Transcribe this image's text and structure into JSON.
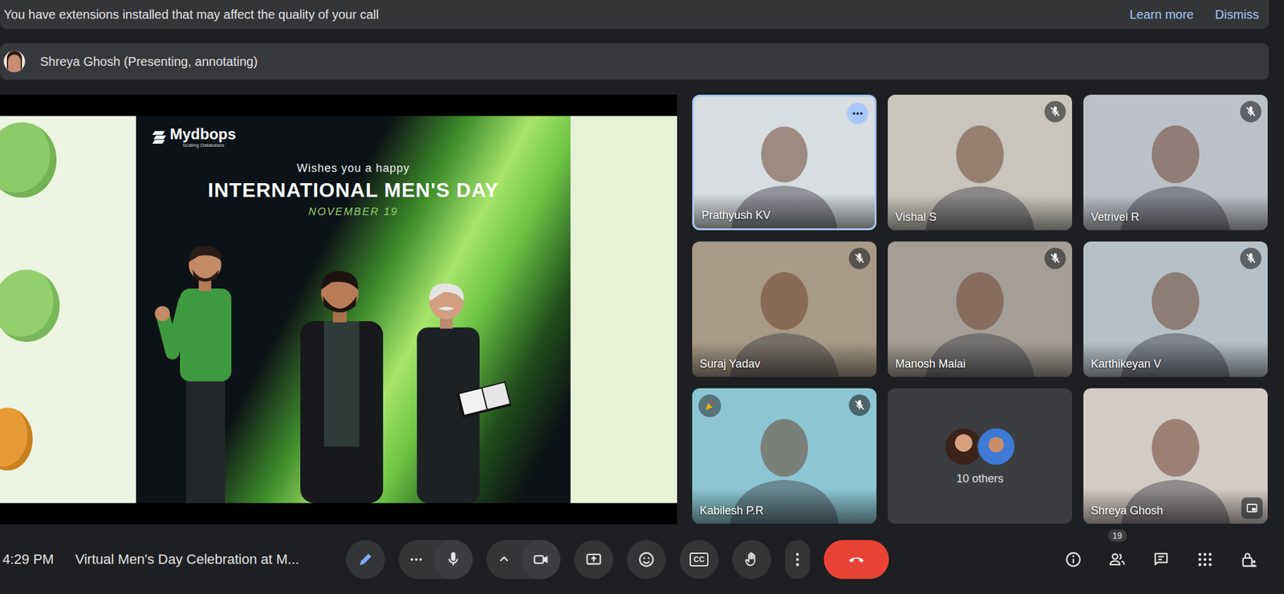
{
  "banner": {
    "message": "You have extensions installed that may affect the quality of your call",
    "actions": [
      "Learn more",
      "Dismiss"
    ]
  },
  "presenter": {
    "label": "Shreya Ghosh (Presenting, annotating)"
  },
  "slide": {
    "brand": "Mydbops",
    "tagline": "Scaling Databases",
    "greeting": "Wishes you a happy",
    "title": "INTERNATIONAL MEN'S DAY",
    "date": "NOVEMBER 19"
  },
  "tiles": [
    {
      "kind": "video",
      "name": "Prathyush KV",
      "muted": false,
      "active": true,
      "reaction": false,
      "pip": false
    },
    {
      "kind": "video",
      "name": "Vishal S",
      "muted": true,
      "active": false,
      "reaction": false,
      "pip": false
    },
    {
      "kind": "video",
      "name": "Vetrivel R",
      "muted": true,
      "active": false,
      "reaction": false,
      "pip": false
    },
    {
      "kind": "video",
      "name": "Suraj Yadav",
      "muted": true,
      "active": false,
      "reaction": false,
      "pip": false
    },
    {
      "kind": "video",
      "name": "Manosh Malai",
      "muted": true,
      "active": false,
      "reaction": false,
      "pip": false
    },
    {
      "kind": "video",
      "name": "Karthikeyan V",
      "muted": true,
      "active": false,
      "reaction": false,
      "pip": false
    },
    {
      "kind": "video",
      "name": "Kabilesh P.R",
      "muted": true,
      "active": false,
      "reaction": true,
      "pip": false
    },
    {
      "kind": "others",
      "name": "10 others",
      "muted": false,
      "active": false,
      "reaction": false,
      "pip": false
    },
    {
      "kind": "video",
      "name": "Shreya Ghosh",
      "muted": false,
      "active": false,
      "reaction": false,
      "pip": true
    }
  ],
  "toolbar": {
    "time": "4:29 PM",
    "meeting_title": "Virtual Men's Day Celebration at M...",
    "controls": [
      {
        "kind": "annotate",
        "active": true,
        "label": ""
      },
      {
        "kind": "mic",
        "active": false,
        "label": ""
      },
      {
        "kind": "camera",
        "active": false,
        "label": ""
      },
      {
        "kind": "present",
        "active": false,
        "label": ""
      },
      {
        "kind": "reactions",
        "active": false,
        "label": ""
      },
      {
        "kind": "captions",
        "active": false,
        "label": "CC"
      },
      {
        "kind": "hand",
        "active": false,
        "label": ""
      },
      {
        "kind": "more",
        "active": false,
        "label": ""
      },
      {
        "kind": "leave",
        "active": false,
        "label": ""
      }
    ],
    "side": [
      {
        "kind": "info",
        "badge": ""
      },
      {
        "kind": "people",
        "badge": "19"
      },
      {
        "kind": "chat",
        "badge": ""
      },
      {
        "kind": "activities",
        "badge": ""
      },
      {
        "kind": "host-controls",
        "badge": ""
      }
    ]
  }
}
